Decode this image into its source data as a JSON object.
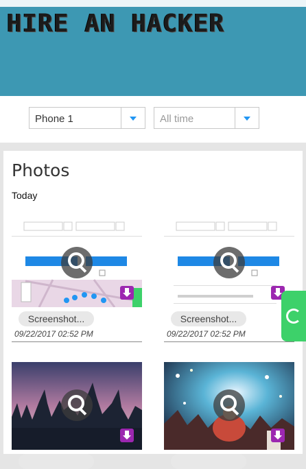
{
  "banner": {
    "title": "HIRE AN HACKER"
  },
  "filters": {
    "device": {
      "value": "Phone 1"
    },
    "time": {
      "value": "All time"
    }
  },
  "photos": {
    "title": "Photos",
    "group_label": "Today",
    "items": [
      {
        "name": "Screenshot...",
        "date": "09/22/2017 02:52 PM",
        "kind": "screenshot"
      },
      {
        "name": "Screenshot...",
        "date": "09/22/2017 02:52 PM",
        "kind": "screenshot"
      },
      {
        "kind": "photo"
      },
      {
        "kind": "photo"
      }
    ]
  },
  "icons": {
    "view": "magnifier-icon",
    "download": "download-icon",
    "refresh": "refresh-icon",
    "dropdown": "chevron-down-icon"
  },
  "colors": {
    "banner": "#3d98b3",
    "accent": "#2196f3",
    "download": "#9c27b0",
    "refresh_tab": "#3dd16a"
  }
}
